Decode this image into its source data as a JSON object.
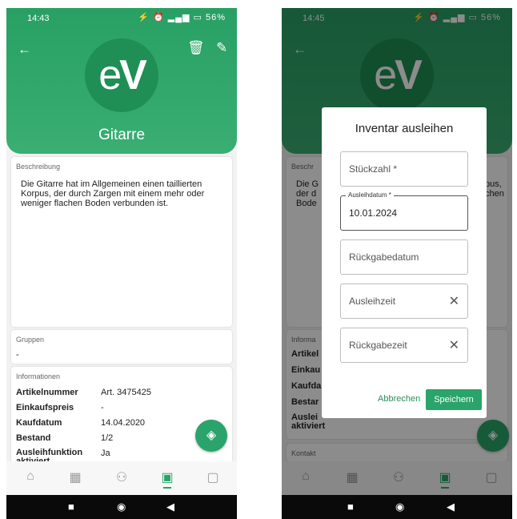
{
  "left": {
    "status_time": "14:43",
    "status_icons": "⚡ ⏰ ▂▄▆ ▭ 56%",
    "title": "Gitarre",
    "logo_e": "e",
    "logo_v": "V",
    "description_label": "Beschreibung",
    "description_text": "Die Gitarre hat im Allgemeinen einen taillierten Korpus, der durch Zargen mit einem mehr oder weniger flachen Boden verbunden ist.",
    "groups_label": "Gruppen",
    "groups_value": "-",
    "info_label": "Informationen",
    "info_rows": [
      {
        "key": "Artikelnummer",
        "value": "Art. 3475425"
      },
      {
        "key": "Einkaufspreis",
        "value": "-"
      },
      {
        "key": "Kaufdatum",
        "value": "14.04.2020"
      },
      {
        "key": "Bestand",
        "value": "1/2"
      },
      {
        "key": "Ausleihfunktion aktiviert",
        "value": "Ja"
      }
    ]
  },
  "right": {
    "status_time": "14:45",
    "status_icons": "⚡ ⏰ ▂▄▆ ▭ 56%",
    "description_label": "Beschr",
    "desc_left": "Die G der d Bode",
    "desc_right": "pus, chen",
    "info_label": "Informa",
    "info_keys": [
      "Artikel",
      "Einkau",
      "Kaufda",
      "Bestar",
      "Auslei aktiviert"
    ],
    "kontakt_label": "Kontakt",
    "dialog": {
      "title": "Inventar ausleihen",
      "quantity_placeholder": "Stückzahl *",
      "loan_date_label": "Ausleihdatum *",
      "loan_date_value": "10.01.2024",
      "return_date_placeholder": "Rückgabedatum",
      "loan_time_placeholder": "Ausleihzeit",
      "return_time_placeholder": "Rückgabezeit",
      "cancel_label": "Abbrechen",
      "save_label": "Speichern"
    }
  },
  "icons": {
    "back": "←",
    "trash": "🗑",
    "edit": "✎",
    "fab": "◈",
    "clear": "✕",
    "nav_home": "⌂",
    "nav_calendar": "▦",
    "nav_people": "⚇",
    "nav_inventory": "▣",
    "nav_contact": "▢",
    "sys_square": "■",
    "sys_circle": "◉",
    "sys_back": "◀"
  },
  "colors": {
    "brand": "#2aa46a",
    "header": "#28a064"
  }
}
